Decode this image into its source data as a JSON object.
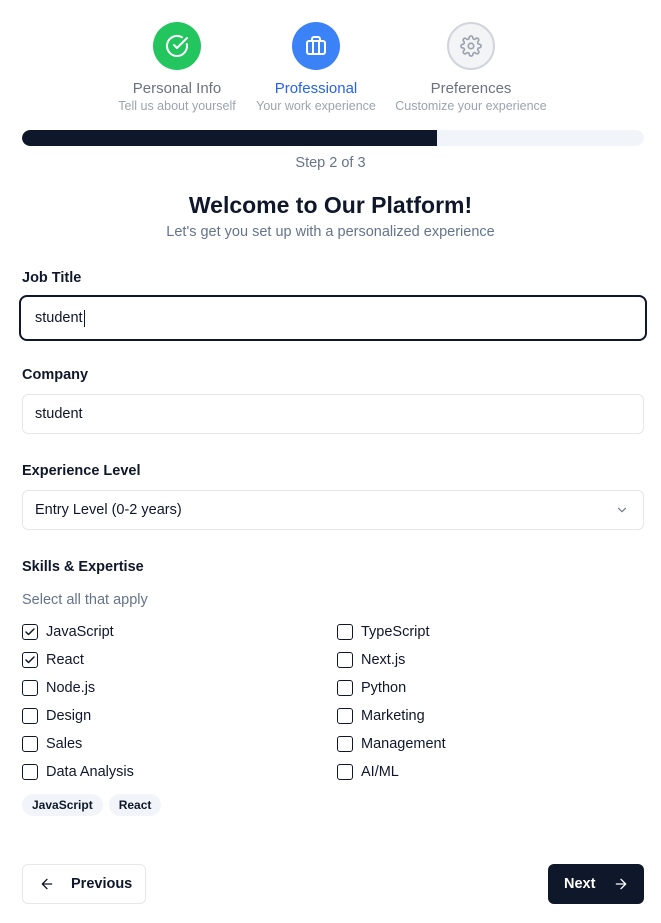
{
  "stepper": {
    "steps": [
      {
        "title": "Personal Info",
        "subtitle": "Tell us about yourself",
        "state": "done",
        "icon": "check-circle-icon"
      },
      {
        "title": "Professional",
        "subtitle": "Your work experience",
        "state": "active",
        "icon": "briefcase-icon"
      },
      {
        "title": "Preferences",
        "subtitle": "Customize your experience",
        "state": "todo",
        "icon": "gear-icon"
      }
    ],
    "progress_fraction": 0.667,
    "progress_text": "Step 2 of 3"
  },
  "header": {
    "title": "Welcome to Our Platform!",
    "subtitle": "Let's get you set up with a personalized experience"
  },
  "form": {
    "job_title": {
      "label": "Job Title",
      "value": "student"
    },
    "company": {
      "label": "Company",
      "value": "student"
    },
    "experience": {
      "label": "Experience Level",
      "value": "Entry Level (0-2 years)"
    },
    "skills": {
      "label": "Skills & Expertise",
      "hint": "Select all that apply",
      "options": [
        {
          "label": "JavaScript",
          "checked": true
        },
        {
          "label": "TypeScript",
          "checked": false
        },
        {
          "label": "React",
          "checked": true
        },
        {
          "label": "Next.js",
          "checked": false
        },
        {
          "label": "Node.js",
          "checked": false
        },
        {
          "label": "Python",
          "checked": false
        },
        {
          "label": "Design",
          "checked": false
        },
        {
          "label": "Marketing",
          "checked": false
        },
        {
          "label": "Sales",
          "checked": false
        },
        {
          "label": "Management",
          "checked": false
        },
        {
          "label": "Data Analysis",
          "checked": false
        },
        {
          "label": "AI/ML",
          "checked": false
        }
      ],
      "selected_tags": [
        "JavaScript",
        "React"
      ]
    }
  },
  "nav": {
    "previous_label": "Previous",
    "next_label": "Next"
  },
  "colors": {
    "done": "#22c55e",
    "active": "#3b82f6",
    "primary": "#0f172a",
    "muted": "#64748b"
  }
}
